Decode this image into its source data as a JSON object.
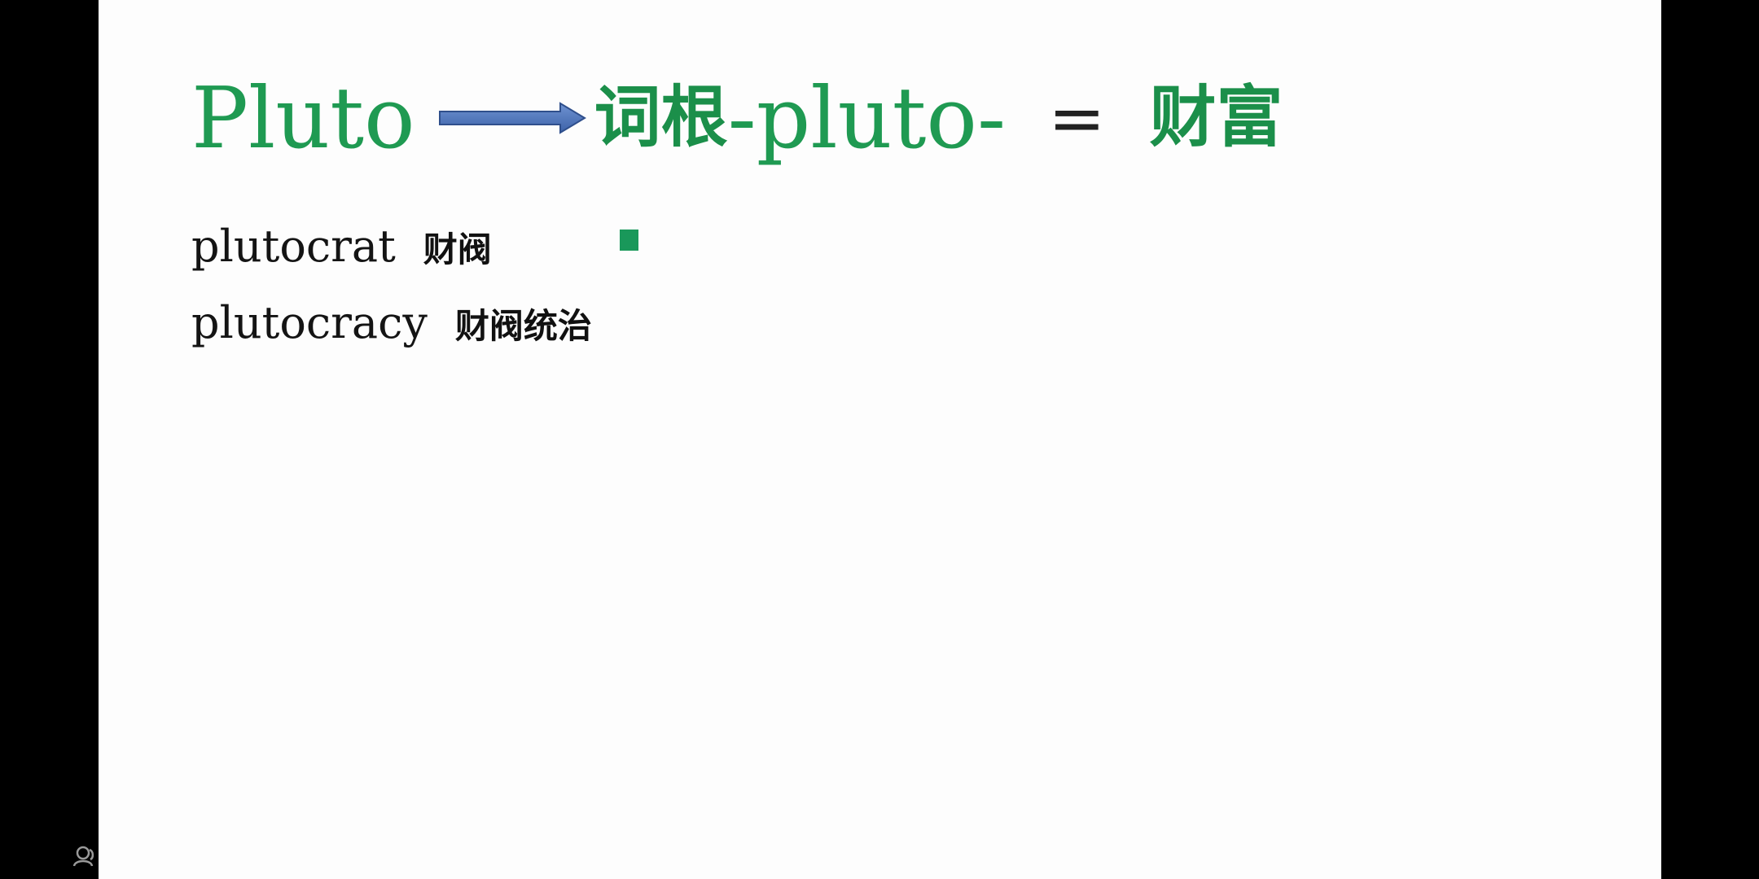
{
  "slide": {
    "title": {
      "source_word": "Pluto",
      "root_prefix_cjk": "词根",
      "root": "-pluto-",
      "equals": "=",
      "meaning": "财富"
    },
    "entries": [
      {
        "word": "plutocrat",
        "meaning": "财阀"
      },
      {
        "word": "plutocracy",
        "meaning": "财阀统治"
      }
    ]
  },
  "colors": {
    "accent_green": "#1f9a52",
    "arrow_blue": "#4a74b8"
  },
  "icons": {
    "arrow": "right-arrow-icon",
    "corner": "user-icon"
  }
}
